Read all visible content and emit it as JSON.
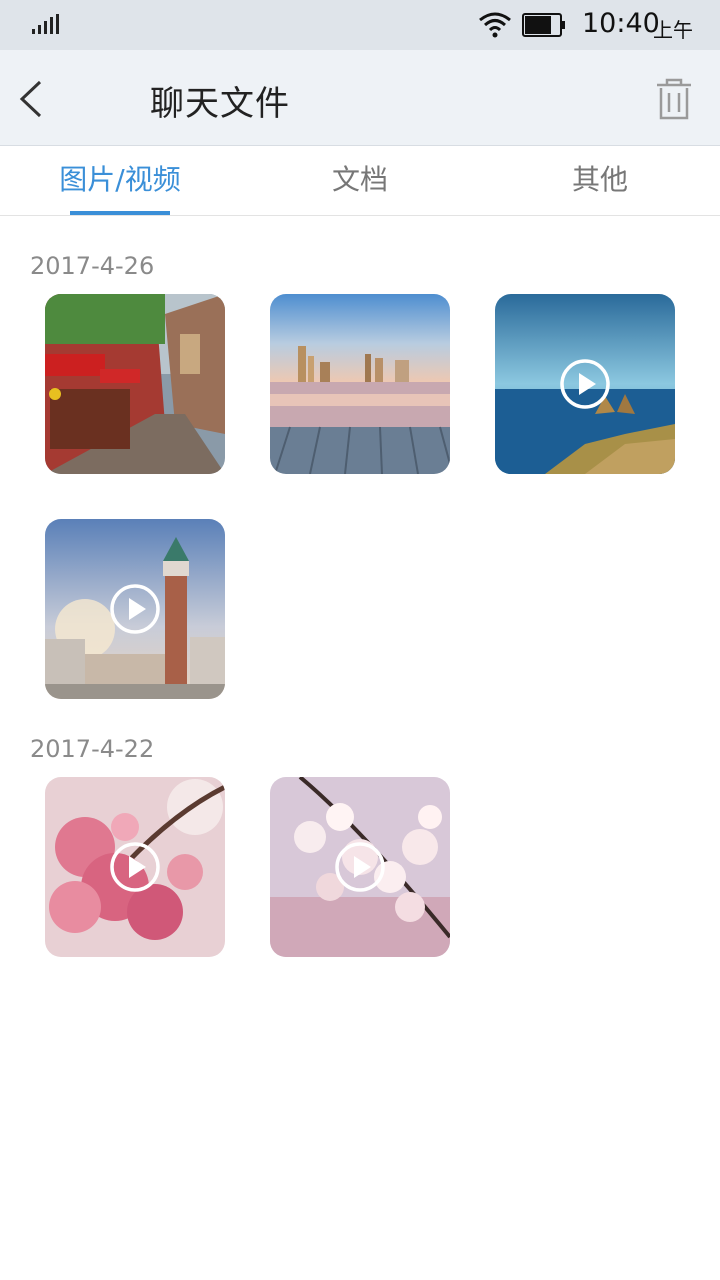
{
  "status_bar": {
    "time": "10:40",
    "ampm": "上午",
    "icons": [
      "signal-icon",
      "wifi-icon",
      "battery-icon"
    ]
  },
  "header": {
    "title": "聊天文件",
    "icons": [
      "back-arrow-icon",
      "trash-icon"
    ]
  },
  "tabs": [
    {
      "label": "图片/视频",
      "active": true
    },
    {
      "label": "文档",
      "active": false
    },
    {
      "label": "其他",
      "active": false
    }
  ],
  "colors": {
    "accent": "#3a8fd8",
    "status_bar_bg": "#dfe4ea",
    "header_bg": "#eef2f6",
    "date_text": "#8a8a8a"
  },
  "groups": [
    {
      "date": "2017-4-26",
      "items": [
        {
          "type": "image",
          "scene": "street"
        },
        {
          "type": "image",
          "scene": "city-pier"
        },
        {
          "type": "video",
          "scene": "sea-rocks"
        },
        {
          "type": "video",
          "scene": "bell-tower"
        }
      ]
    },
    {
      "date": "2017-4-22",
      "items": [
        {
          "type": "video",
          "scene": "pink-blossom"
        },
        {
          "type": "video",
          "scene": "white-blossom"
        }
      ]
    }
  ]
}
